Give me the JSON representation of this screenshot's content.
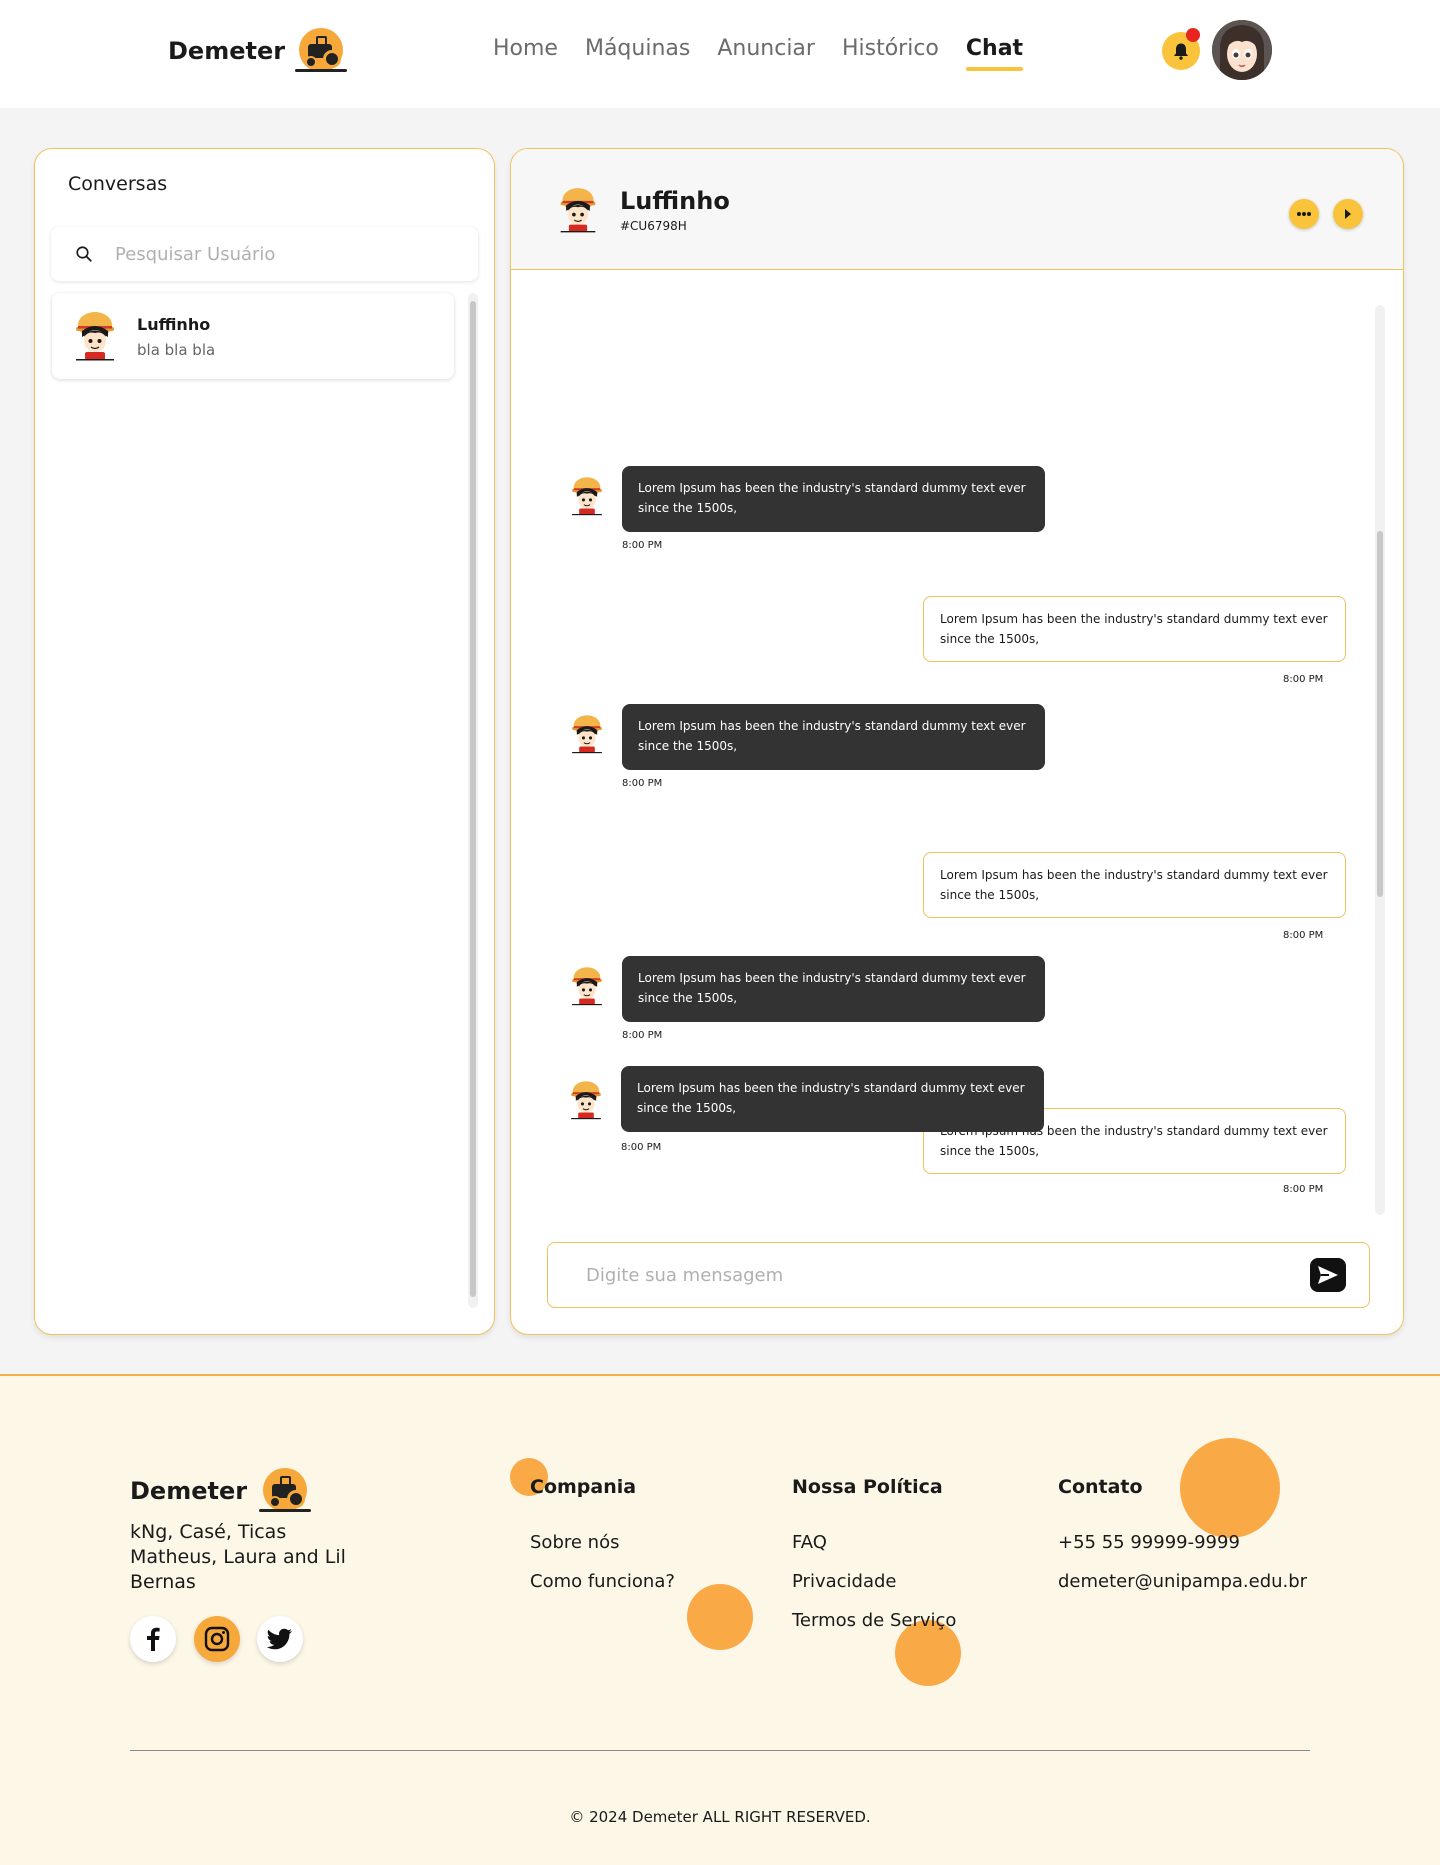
{
  "brand": {
    "name": "Demeter"
  },
  "nav": {
    "items": [
      {
        "label": "Home",
        "active": false
      },
      {
        "label": "Máquinas",
        "active": false
      },
      {
        "label": "Anunciar",
        "active": false
      },
      {
        "label": "Histórico",
        "active": false
      },
      {
        "label": "Chat",
        "active": true
      }
    ]
  },
  "conversations": {
    "title": "Conversas",
    "search_placeholder": "Pesquisar Usuário",
    "items": [
      {
        "name": "Luffinho",
        "preview": "bla bla bla"
      }
    ]
  },
  "chat": {
    "contact_name": "Luffinho",
    "contact_id": "#CU6798H",
    "messages": [
      {
        "direction": "in",
        "text": "Lorem Ipsum has been the industry's standard dummy text ever since the 1500s,",
        "time": "8:00 PM"
      },
      {
        "direction": "out",
        "text": "Lorem Ipsum has been the industry's standard dummy text ever since the 1500s,",
        "time": "8:00 PM"
      },
      {
        "direction": "in",
        "text": "Lorem Ipsum has been the industry's standard dummy text ever since the 1500s,",
        "time": "8:00 PM"
      },
      {
        "direction": "out",
        "text": "Lorem Ipsum has been the industry's standard dummy text ever since the 1500s,",
        "time": "8:00 PM"
      },
      {
        "direction": "in",
        "text": "Lorem Ipsum has been the industry's standard dummy text ever since the 1500s,",
        "time": "8:00 PM"
      },
      {
        "direction": "out",
        "text": "Lorem Ipsum has been the industry's standard dummy text ever since the 1500s,",
        "time": "8:00 PM"
      },
      {
        "direction": "in",
        "text": "Lorem Ipsum has been the industry's standard dummy text ever since the 1500s,",
        "time": "8:00 PM"
      }
    ],
    "composer_placeholder": "Digite sua mensagem"
  },
  "footer": {
    "brand": "Demeter",
    "authors": "kNg, Casé, Ticas Matheus, Laura and Lil Bernas",
    "companhia": {
      "title": "Compania",
      "links": [
        "Sobre nós",
        "Como funciona?"
      ]
    },
    "politica": {
      "title": "Nossa Política",
      "links": [
        "FAQ",
        "Privacidade",
        "Termos de Serviço"
      ]
    },
    "contato": {
      "title": "Contato",
      "phone": "+55 55 99999-9999",
      "email": "demeter@unipampa.edu.br"
    },
    "copyright": "© 2024 Demeter ALL RIGHT RESERVED."
  },
  "icons": {
    "notification": "bell-icon",
    "search": "search-icon",
    "more": "more-horizontal-icon",
    "next": "play-right-icon",
    "send": "send-icon",
    "social": [
      "facebook-icon",
      "instagram-icon",
      "twitter-icon"
    ]
  },
  "colors": {
    "accent": "#f9c43c",
    "orange": "#f6a83a",
    "border": "#f0c25e",
    "incoming_bubble": "#333333",
    "footer_bg": "#fdf7e8",
    "notification_dot": "#e8251f"
  }
}
